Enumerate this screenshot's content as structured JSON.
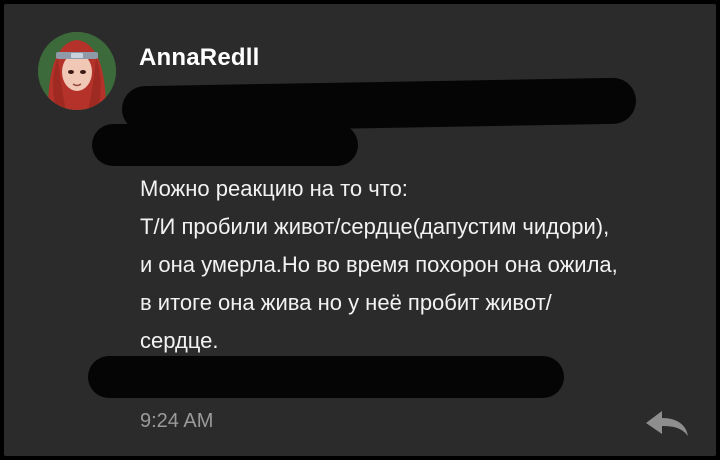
{
  "message": {
    "sender": "AnnaRedll",
    "lines": [
      "Можно реакцию на то что:",
      "Т/И пробили живот/сердце(дапустим чидори),",
      "и она умерла.Но во время похорон она ожила,",
      "в итоге она жива но у неё пробит живот/",
      "сердце."
    ],
    "timestamp": "9:24 AM"
  },
  "icons": {
    "avatar": "user-avatar",
    "reply": "reply-arrow-icon"
  },
  "colors": {
    "card_background": "#2b2b2b",
    "text": "#f2f2f2",
    "timestamp": "#9a9a9a",
    "redaction": "#050505"
  }
}
